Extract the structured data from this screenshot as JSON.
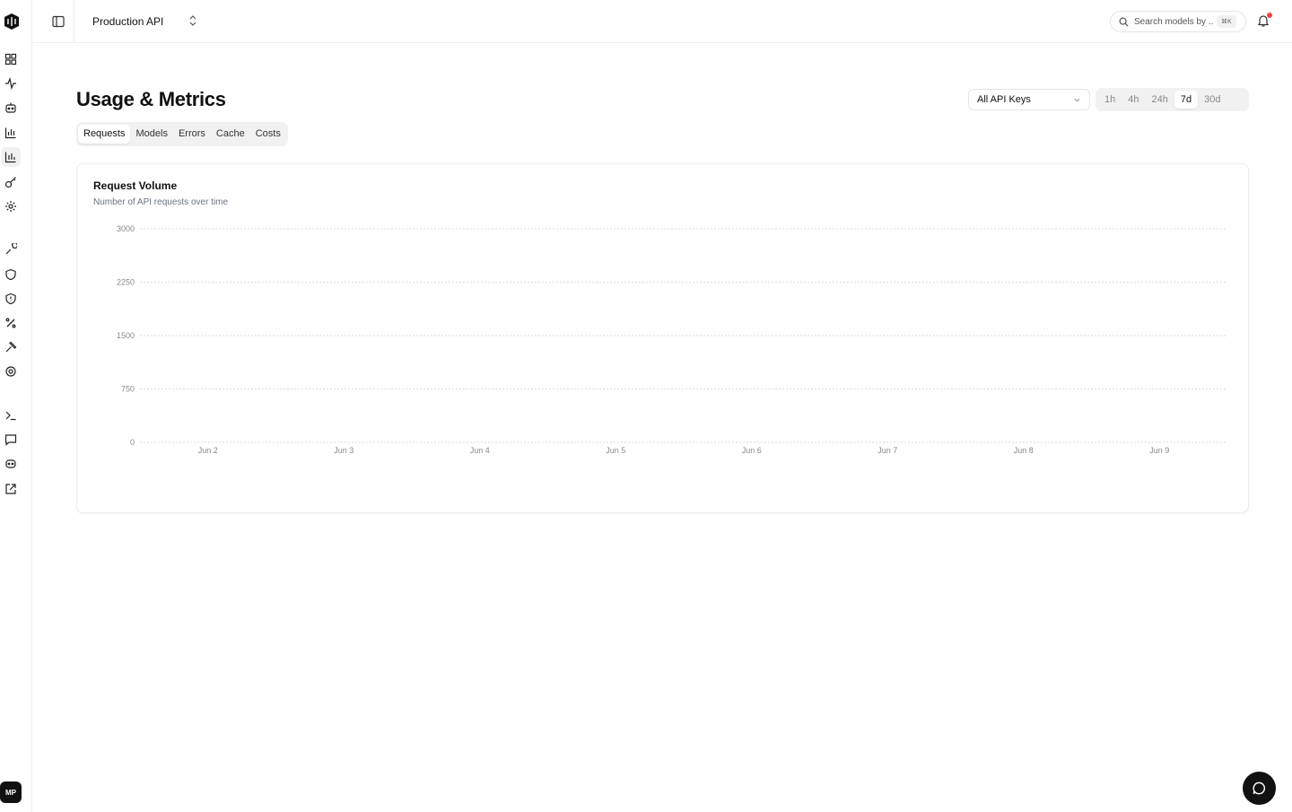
{
  "header": {
    "project_name": "Production API",
    "search_placeholder": "Search models by ...",
    "search_shortcut": "⌘K"
  },
  "sidebar": {
    "icons": [
      "logo-icon",
      "dashboard-icon",
      "activity-icon",
      "bot-icon",
      "bar-chart-icon",
      "analytics-icon",
      "key-icon",
      "settings-icon",
      "wrench-icon",
      "shield-icon",
      "shield-alert-icon",
      "percent-icon",
      "hammer-icon",
      "gear-icon",
      "terminal-icon",
      "message-icon",
      "assistant-icon",
      "external-link-icon"
    ],
    "avatar_initials": "MP"
  },
  "page": {
    "title": "Usage & Metrics",
    "api_key_filter": "All API Keys",
    "time_ranges": [
      "1h",
      "4h",
      "24h",
      "7d",
      "30d"
    ],
    "active_range": "7d",
    "tabs": [
      "Requests",
      "Models",
      "Errors",
      "Cache",
      "Costs"
    ],
    "active_tab": "Requests"
  },
  "card": {
    "title": "Request Volume",
    "subtitle": "Number of API requests over time"
  },
  "chart_data": {
    "type": "line",
    "title": "Request Volume",
    "subtitle": "Number of API requests over time",
    "x": [
      "Jun 2",
      "Jun 3",
      "Jun 4",
      "Jun 5",
      "Jun 6",
      "Jun 7",
      "Jun 8",
      "Jun 9"
    ],
    "yticks": [
      0,
      750,
      1500,
      2250,
      3000
    ],
    "ylim": [
      0,
      3000
    ],
    "series": [],
    "grid": true
  }
}
